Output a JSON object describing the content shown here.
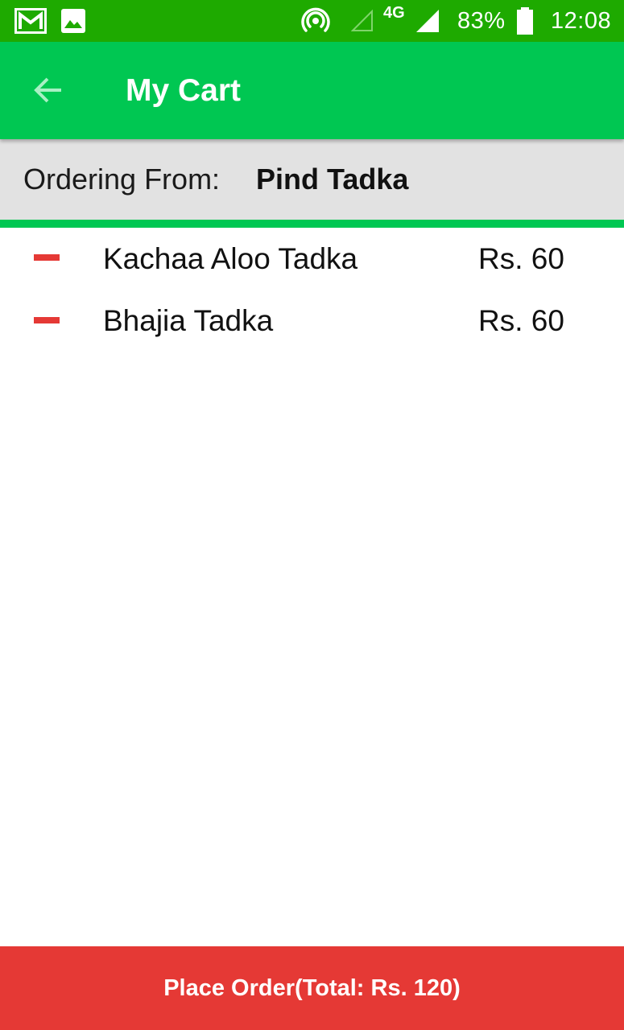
{
  "status_bar": {
    "battery": "83%",
    "network": "4G",
    "time": "12:08",
    "icons": [
      "gmail-icon",
      "image-icon",
      "hotspot-icon",
      "signal-empty-icon",
      "signal-full-icon",
      "battery-icon"
    ]
  },
  "app_bar": {
    "title": "My Cart",
    "back_icon": "arrow-back-icon"
  },
  "order_info": {
    "label": "Ordering From:",
    "restaurant": "Pind Tadka"
  },
  "cart": {
    "items": [
      {
        "name": "Kachaa Aloo Tadka",
        "price": "Rs. 60"
      },
      {
        "name": "Bhajia Tadka",
        "price": "Rs. 60"
      }
    ]
  },
  "footer": {
    "place_order_label": "Place Order(Total: Rs. 120)"
  },
  "colors": {
    "status_bar": "#1eaa00",
    "app_bar": "#00c752",
    "accent": "#00c752",
    "info_background": "#e2e2e2",
    "remove": "#e53935",
    "place_order": "#e53935"
  }
}
